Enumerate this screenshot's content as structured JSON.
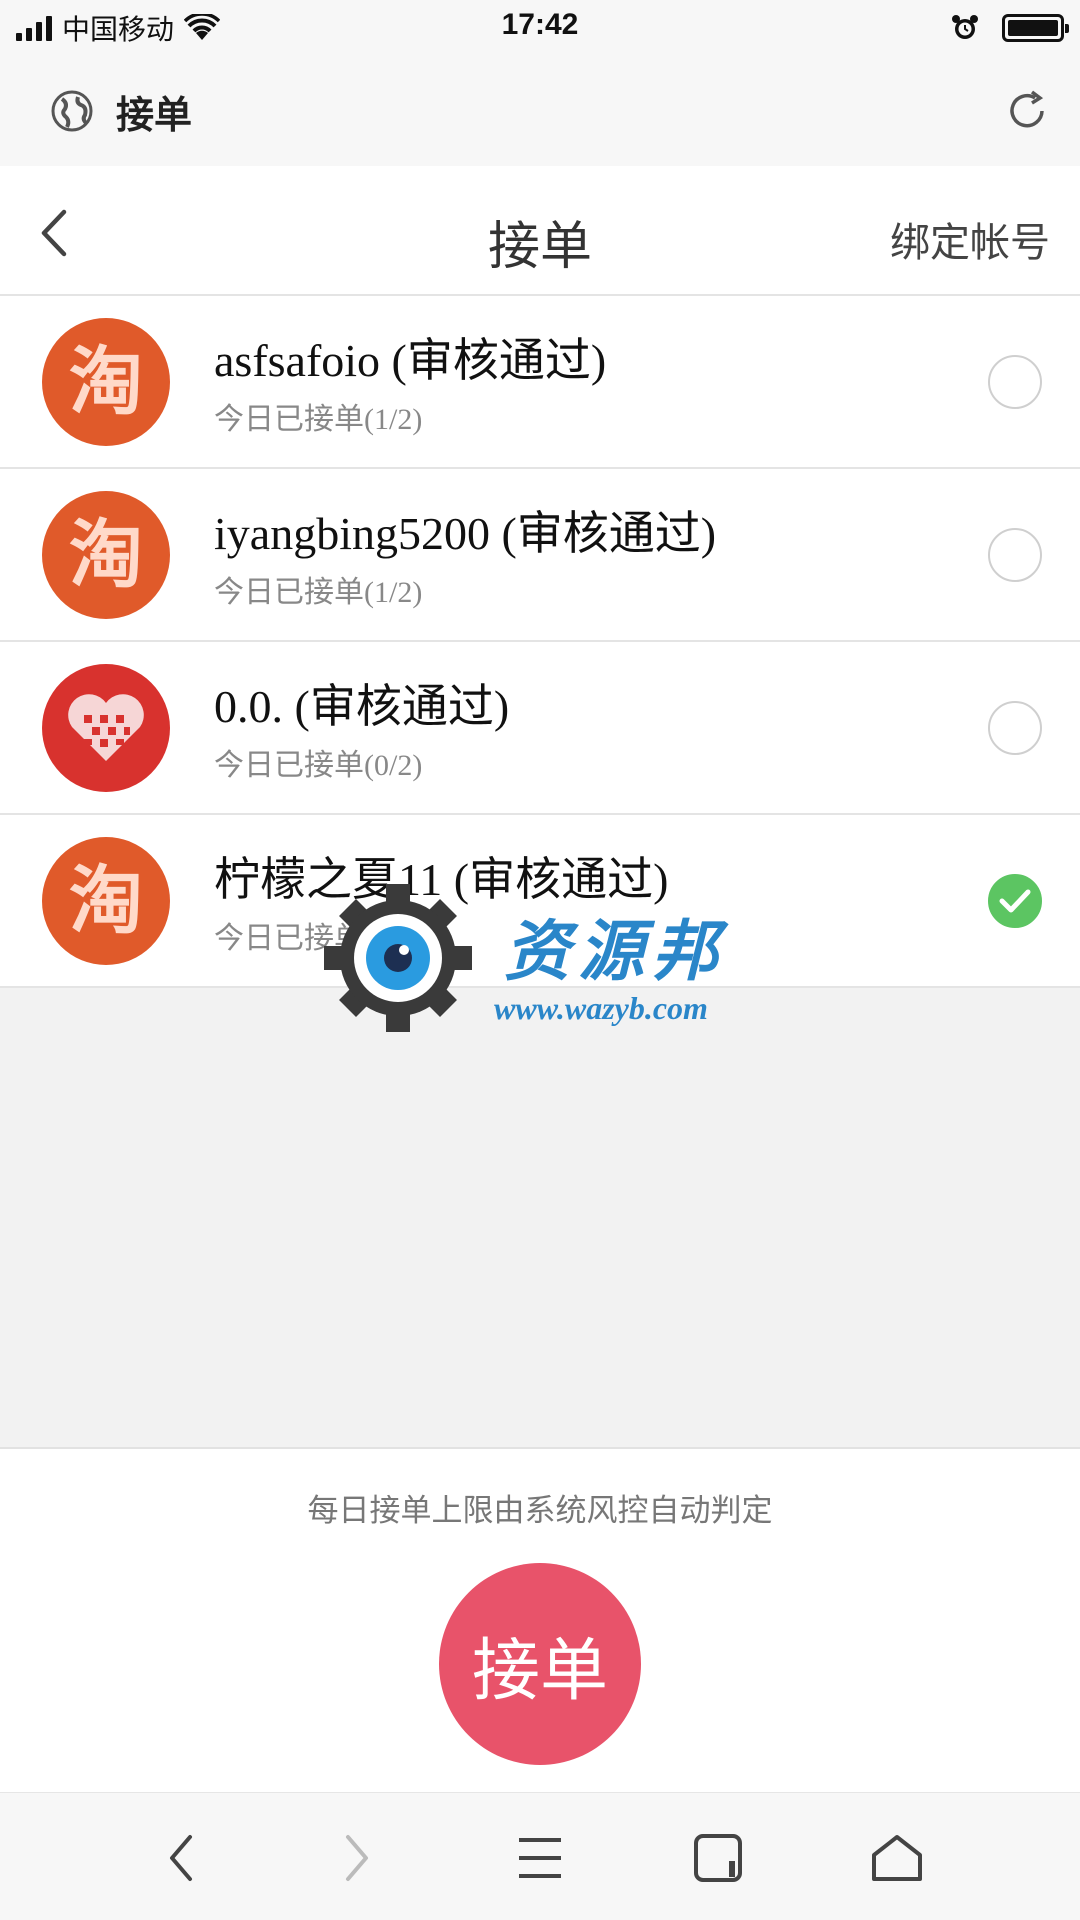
{
  "status_bar": {
    "carrier": "中国移动",
    "time": "17:42"
  },
  "browser": {
    "title": "接单"
  },
  "header": {
    "title": "接单",
    "action_label": "绑定帐号"
  },
  "accounts": [
    {
      "name": "asfsafoio (审核通过)",
      "sub": "今日已接单(1/2)",
      "avatar": "taobao-icon",
      "avatar_glyph": "淘",
      "selected": false
    },
    {
      "name": "iyangbing5200 (审核通过)",
      "sub": "今日已接单(1/2)",
      "avatar": "taobao-icon",
      "avatar_glyph": "淘",
      "selected": false
    },
    {
      "name": "0.0. (审核通过)",
      "sub": "今日已接单(0/2)",
      "avatar": "heart-icon",
      "avatar_glyph": "",
      "selected": false
    },
    {
      "name": "柠檬之夏11 (审核通过)",
      "sub": "今日已接单",
      "avatar": "taobao-icon",
      "avatar_glyph": "淘",
      "selected": true
    }
  ],
  "watermark": {
    "text": "资源邦",
    "url": "www.wazyb.com"
  },
  "footer": {
    "note": "每日接单上限由系统风控自动判定",
    "accept_label": "接单"
  },
  "colors": {
    "accent_red": "#e8536a",
    "check_green": "#5cc562",
    "taobao_orange": "#e05a2a",
    "watermark_blue": "#2a86c9"
  },
  "icons": {
    "browser_site": "globe-icon",
    "browser_reload": "refresh-icon",
    "nav_back": "chevron-left-icon",
    "toolbar": [
      "back-icon",
      "forward-icon",
      "menu-icon",
      "tabs-icon",
      "home-icon"
    ]
  }
}
